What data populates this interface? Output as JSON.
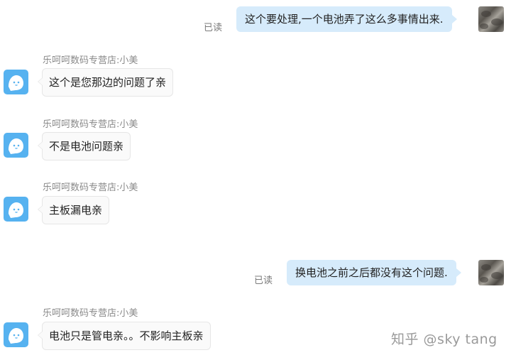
{
  "messages": [
    {
      "side": "right",
      "text": "这个要处理,一个电池弄了这么多事情出来.",
      "status": "已读"
    },
    {
      "side": "left",
      "sender": "乐呵呵数码专营店:小美",
      "text": "这个是您那边的问题了亲"
    },
    {
      "side": "left",
      "sender": "乐呵呵数码专营店:小美",
      "text": "不是电池问题亲"
    },
    {
      "side": "left",
      "sender": "乐呵呵数码专营店:小美",
      "text": "主板漏电亲"
    },
    {
      "side": "right",
      "text": "换电池之前之后都没有这个问题.",
      "status": "已读"
    },
    {
      "side": "left",
      "sender": "乐呵呵数码专营店:小美",
      "text": "电池只是管电亲。。不影响主板亲"
    }
  ],
  "watermark": "知乎 @sky tang",
  "colors": {
    "right_bubble": "#d6ebfb",
    "left_bubble": "#fafafa",
    "bot_avatar": "#56b2f0"
  },
  "icons": {
    "shop_avatar": "bot-face-icon",
    "user_avatar": "user-photo-avatar"
  }
}
